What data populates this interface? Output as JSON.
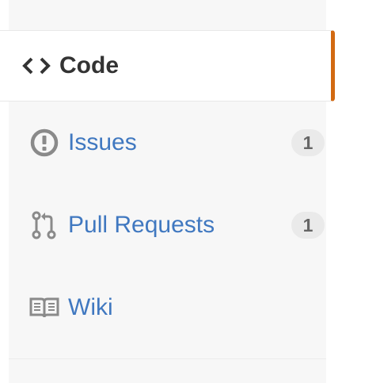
{
  "nav": {
    "items": [
      {
        "label": "Code",
        "icon": "code-icon",
        "selected": true
      },
      {
        "label": "Issues",
        "icon": "issue-opened-icon",
        "count": "1"
      },
      {
        "label": "Pull Requests",
        "icon": "git-pull-request-icon",
        "count": "1"
      },
      {
        "label": "Wiki",
        "icon": "book-icon"
      }
    ]
  },
  "colors": {
    "link": "#4078c0",
    "selected_text": "#333333",
    "selected_border": "#d26911",
    "badge_bg": "#eaeaea",
    "sidebar_bg": "#f7f7f7"
  }
}
